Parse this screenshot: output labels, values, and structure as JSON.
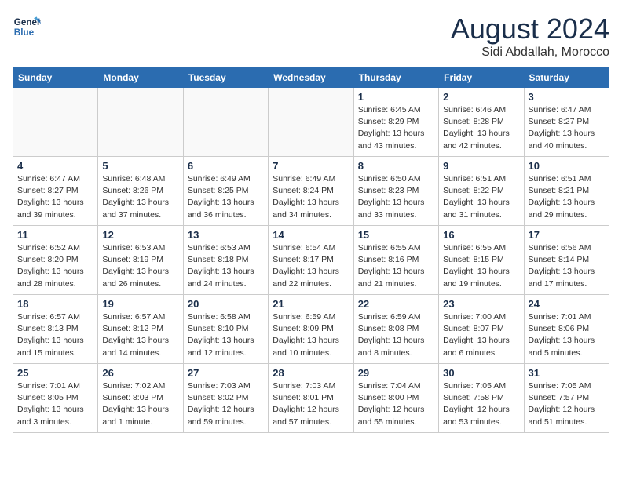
{
  "logo": {
    "line1": "General",
    "line2": "Blue"
  },
  "header": {
    "month": "August 2024",
    "location": "Sidi Abdallah, Morocco"
  },
  "weekdays": [
    "Sunday",
    "Monday",
    "Tuesday",
    "Wednesday",
    "Thursday",
    "Friday",
    "Saturday"
  ],
  "weeks": [
    [
      {
        "day": "",
        "detail": ""
      },
      {
        "day": "",
        "detail": ""
      },
      {
        "day": "",
        "detail": ""
      },
      {
        "day": "",
        "detail": ""
      },
      {
        "day": "1",
        "detail": "Sunrise: 6:45 AM\nSunset: 8:29 PM\nDaylight: 13 hours\nand 43 minutes."
      },
      {
        "day": "2",
        "detail": "Sunrise: 6:46 AM\nSunset: 8:28 PM\nDaylight: 13 hours\nand 42 minutes."
      },
      {
        "day": "3",
        "detail": "Sunrise: 6:47 AM\nSunset: 8:27 PM\nDaylight: 13 hours\nand 40 minutes."
      }
    ],
    [
      {
        "day": "4",
        "detail": "Sunrise: 6:47 AM\nSunset: 8:27 PM\nDaylight: 13 hours\nand 39 minutes."
      },
      {
        "day": "5",
        "detail": "Sunrise: 6:48 AM\nSunset: 8:26 PM\nDaylight: 13 hours\nand 37 minutes."
      },
      {
        "day": "6",
        "detail": "Sunrise: 6:49 AM\nSunset: 8:25 PM\nDaylight: 13 hours\nand 36 minutes."
      },
      {
        "day": "7",
        "detail": "Sunrise: 6:49 AM\nSunset: 8:24 PM\nDaylight: 13 hours\nand 34 minutes."
      },
      {
        "day": "8",
        "detail": "Sunrise: 6:50 AM\nSunset: 8:23 PM\nDaylight: 13 hours\nand 33 minutes."
      },
      {
        "day": "9",
        "detail": "Sunrise: 6:51 AM\nSunset: 8:22 PM\nDaylight: 13 hours\nand 31 minutes."
      },
      {
        "day": "10",
        "detail": "Sunrise: 6:51 AM\nSunset: 8:21 PM\nDaylight: 13 hours\nand 29 minutes."
      }
    ],
    [
      {
        "day": "11",
        "detail": "Sunrise: 6:52 AM\nSunset: 8:20 PM\nDaylight: 13 hours\nand 28 minutes."
      },
      {
        "day": "12",
        "detail": "Sunrise: 6:53 AM\nSunset: 8:19 PM\nDaylight: 13 hours\nand 26 minutes."
      },
      {
        "day": "13",
        "detail": "Sunrise: 6:53 AM\nSunset: 8:18 PM\nDaylight: 13 hours\nand 24 minutes."
      },
      {
        "day": "14",
        "detail": "Sunrise: 6:54 AM\nSunset: 8:17 PM\nDaylight: 13 hours\nand 22 minutes."
      },
      {
        "day": "15",
        "detail": "Sunrise: 6:55 AM\nSunset: 8:16 PM\nDaylight: 13 hours\nand 21 minutes."
      },
      {
        "day": "16",
        "detail": "Sunrise: 6:55 AM\nSunset: 8:15 PM\nDaylight: 13 hours\nand 19 minutes."
      },
      {
        "day": "17",
        "detail": "Sunrise: 6:56 AM\nSunset: 8:14 PM\nDaylight: 13 hours\nand 17 minutes."
      }
    ],
    [
      {
        "day": "18",
        "detail": "Sunrise: 6:57 AM\nSunset: 8:13 PM\nDaylight: 13 hours\nand 15 minutes."
      },
      {
        "day": "19",
        "detail": "Sunrise: 6:57 AM\nSunset: 8:12 PM\nDaylight: 13 hours\nand 14 minutes."
      },
      {
        "day": "20",
        "detail": "Sunrise: 6:58 AM\nSunset: 8:10 PM\nDaylight: 13 hours\nand 12 minutes."
      },
      {
        "day": "21",
        "detail": "Sunrise: 6:59 AM\nSunset: 8:09 PM\nDaylight: 13 hours\nand 10 minutes."
      },
      {
        "day": "22",
        "detail": "Sunrise: 6:59 AM\nSunset: 8:08 PM\nDaylight: 13 hours\nand 8 minutes."
      },
      {
        "day": "23",
        "detail": "Sunrise: 7:00 AM\nSunset: 8:07 PM\nDaylight: 13 hours\nand 6 minutes."
      },
      {
        "day": "24",
        "detail": "Sunrise: 7:01 AM\nSunset: 8:06 PM\nDaylight: 13 hours\nand 5 minutes."
      }
    ],
    [
      {
        "day": "25",
        "detail": "Sunrise: 7:01 AM\nSunset: 8:05 PM\nDaylight: 13 hours\nand 3 minutes."
      },
      {
        "day": "26",
        "detail": "Sunrise: 7:02 AM\nSunset: 8:03 PM\nDaylight: 13 hours\nand 1 minute."
      },
      {
        "day": "27",
        "detail": "Sunrise: 7:03 AM\nSunset: 8:02 PM\nDaylight: 12 hours\nand 59 minutes."
      },
      {
        "day": "28",
        "detail": "Sunrise: 7:03 AM\nSunset: 8:01 PM\nDaylight: 12 hours\nand 57 minutes."
      },
      {
        "day": "29",
        "detail": "Sunrise: 7:04 AM\nSunset: 8:00 PM\nDaylight: 12 hours\nand 55 minutes."
      },
      {
        "day": "30",
        "detail": "Sunrise: 7:05 AM\nSunset: 7:58 PM\nDaylight: 12 hours\nand 53 minutes."
      },
      {
        "day": "31",
        "detail": "Sunrise: 7:05 AM\nSunset: 7:57 PM\nDaylight: 12 hours\nand 51 minutes."
      }
    ]
  ]
}
